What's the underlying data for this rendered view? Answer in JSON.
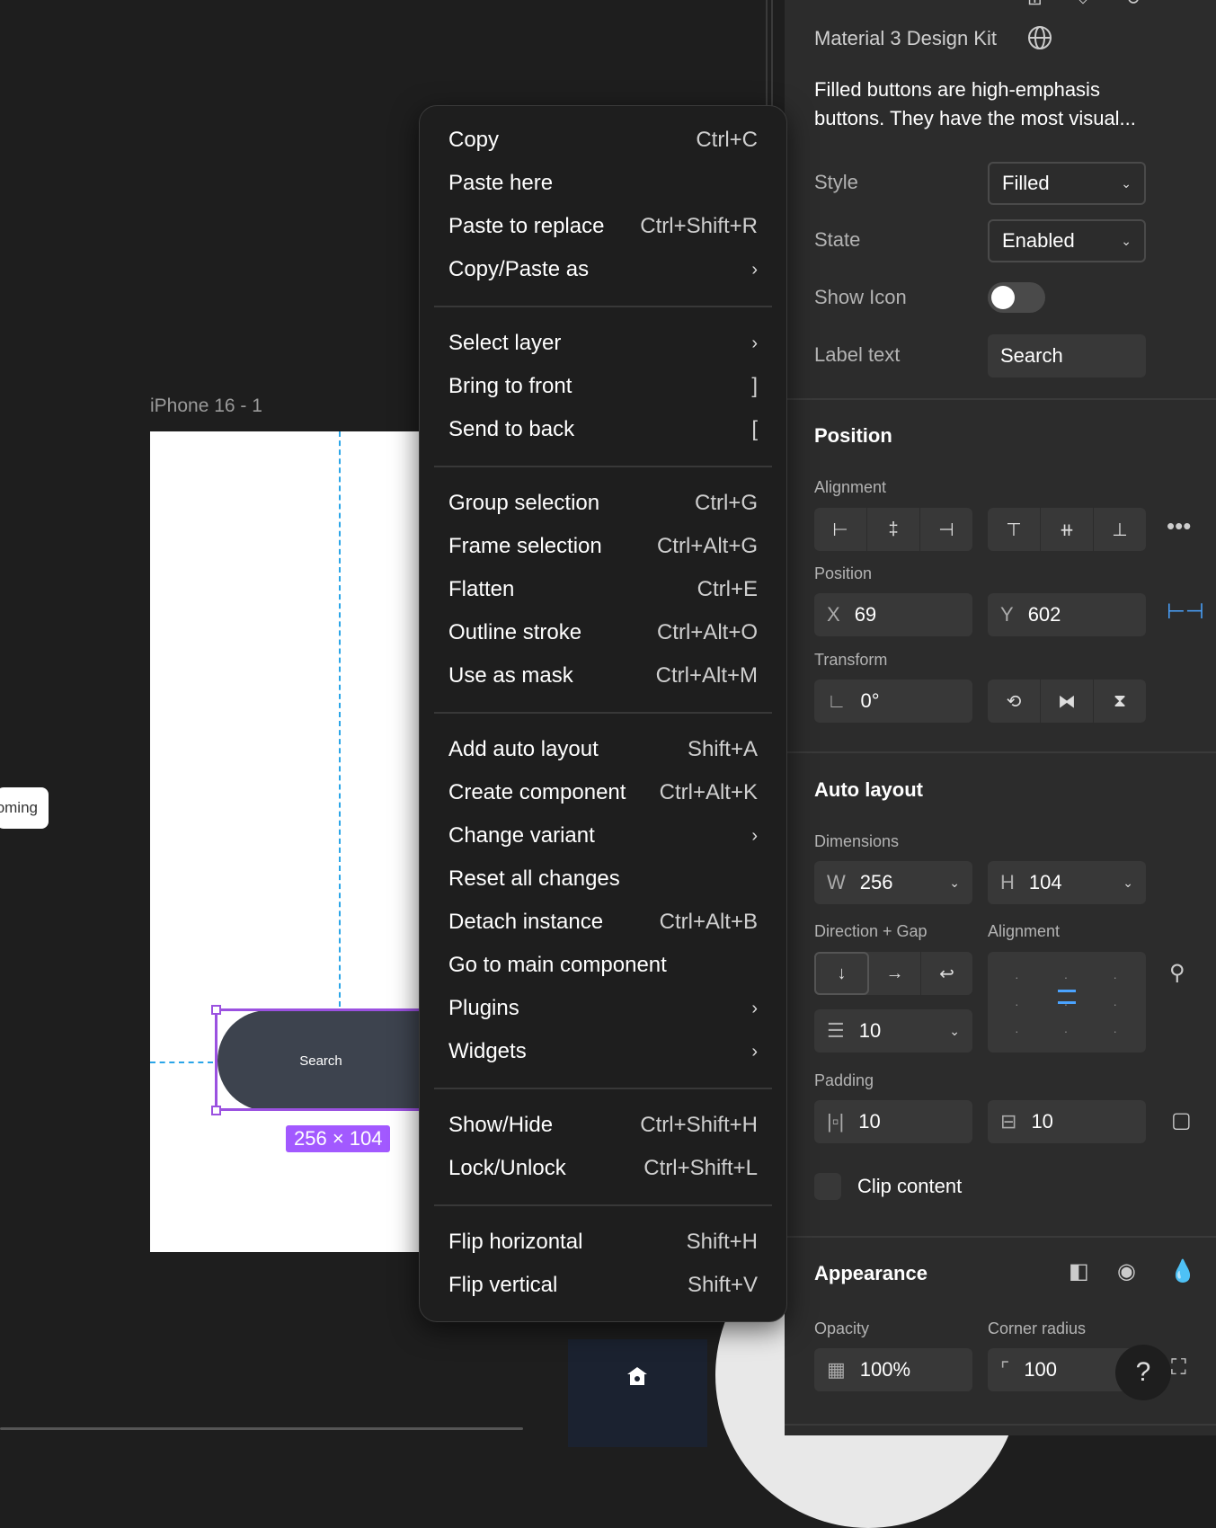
{
  "canvas": {
    "frame_label": "iPhone 16 - 1",
    "button_label": "Search",
    "size_badge": "256 × 104",
    "left_pill_text": "oming"
  },
  "context_menu": {
    "groups": [
      [
        {
          "label": "Copy",
          "shortcut": "Ctrl+C"
        },
        {
          "label": "Paste here",
          "shortcut": ""
        },
        {
          "label": "Paste to replace",
          "shortcut": "Ctrl+Shift+R"
        },
        {
          "label": "Copy/Paste as",
          "shortcut": "›"
        }
      ],
      [
        {
          "label": "Select layer",
          "shortcut": "›"
        },
        {
          "label": "Bring to front",
          "shortcut": "]"
        },
        {
          "label": "Send to back",
          "shortcut": "["
        }
      ],
      [
        {
          "label": "Group selection",
          "shortcut": "Ctrl+G"
        },
        {
          "label": "Frame selection",
          "shortcut": "Ctrl+Alt+G"
        },
        {
          "label": "Flatten",
          "shortcut": "Ctrl+E"
        },
        {
          "label": "Outline stroke",
          "shortcut": "Ctrl+Alt+O"
        },
        {
          "label": "Use as mask",
          "shortcut": "Ctrl+Alt+M"
        }
      ],
      [
        {
          "label": "Add auto layout",
          "shortcut": "Shift+A"
        },
        {
          "label": "Create component",
          "shortcut": "Ctrl+Alt+K"
        },
        {
          "label": "Change variant",
          "shortcut": "›"
        },
        {
          "label": "Reset all changes",
          "shortcut": ""
        },
        {
          "label": "Detach instance",
          "shortcut": "Ctrl+Alt+B"
        },
        {
          "label": "Go to main component",
          "shortcut": ""
        },
        {
          "label": "Plugins",
          "shortcut": "›"
        },
        {
          "label": "Widgets",
          "shortcut": "›"
        }
      ],
      [
        {
          "label": "Show/Hide",
          "shortcut": "Ctrl+Shift+H"
        },
        {
          "label": "Lock/Unlock",
          "shortcut": "Ctrl+Shift+L"
        }
      ],
      [
        {
          "label": "Flip horizontal",
          "shortcut": "Shift+H"
        },
        {
          "label": "Flip vertical",
          "shortcut": "Shift+V"
        }
      ]
    ]
  },
  "panel": {
    "library": "Material 3 Design Kit",
    "description": "Filled buttons are high-emphasis buttons. They have the most visual...",
    "props": {
      "style_label": "Style",
      "style_value": "Filled",
      "state_label": "State",
      "state_value": "Enabled",
      "show_icon_label": "Show Icon",
      "label_text_label": "Label text",
      "label_text_value": "Search"
    },
    "position": {
      "title": "Position",
      "alignment_label": "Alignment",
      "position_label": "Position",
      "x_prefix": "X",
      "x_value": "69",
      "y_prefix": "Y",
      "y_value": "602",
      "transform_label": "Transform",
      "rotation": "0°"
    },
    "auto_layout": {
      "title": "Auto layout",
      "dimensions_label": "Dimensions",
      "w_prefix": "W",
      "w_value": "256",
      "h_prefix": "H",
      "h_value": "104",
      "direction_label": "Direction + Gap",
      "alignment_label": "Alignment",
      "gap_value": "10",
      "padding_label": "Padding",
      "padding_h": "10",
      "padding_v": "10",
      "clip_label": "Clip content"
    },
    "appearance": {
      "title": "Appearance",
      "opacity_label": "Opacity",
      "opacity_value": "100%",
      "radius_label": "Corner radius",
      "radius_value": "100"
    },
    "help": "?"
  },
  "colors": {
    "selection": "#9b51e0",
    "badge": "#a259ff",
    "guide": "#2aa5e8"
  }
}
